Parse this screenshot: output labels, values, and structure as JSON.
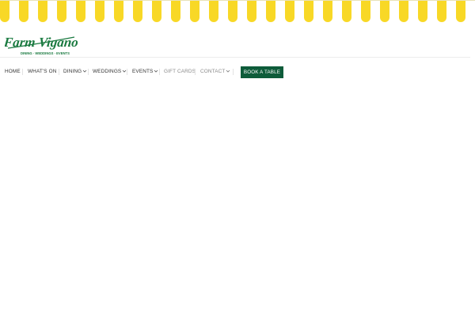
{
  "brand": {
    "name": "Farm Vigano",
    "tagline": "DINING · WEDDINGS · EVENTS",
    "colors": {
      "awning_yellow": "#f8d826",
      "awning_white": "#ffffff",
      "brand_green": "#1a7a40",
      "button_green": "#0e5c3a"
    }
  },
  "nav": {
    "items": [
      {
        "label": "HOME",
        "dropdown": false
      },
      {
        "label": "WHAT'S ON",
        "dropdown": false
      },
      {
        "label": "DINING",
        "dropdown": true
      },
      {
        "label": "WEDDINGS",
        "dropdown": true
      },
      {
        "label": "EVENTS",
        "dropdown": true
      },
      {
        "label": "GIFT CARDS",
        "dropdown": false
      },
      {
        "label": "CONTACT",
        "dropdown": true
      }
    ],
    "cta_label": "BOOK A TABLE"
  },
  "icons": {
    "dropdown": "chevron-down-icon"
  }
}
